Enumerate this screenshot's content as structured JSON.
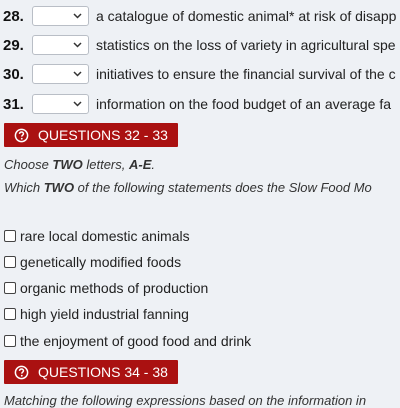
{
  "questions": [
    {
      "number": "28.",
      "text": "a catalogue of domestic animal* at risk of disapp",
      "selected": ""
    },
    {
      "number": "29.",
      "text": "statistics on the loss of variety in agricultural spe",
      "selected": ""
    },
    {
      "number": "30.",
      "text": "initiatives to ensure the financial survival of the c",
      "selected": ""
    },
    {
      "number": "31.",
      "text": "information on the food budget of an average fa",
      "selected": ""
    }
  ],
  "section_32_33": {
    "banner": "QUESTIONS 32 - 33",
    "instruction1": {
      "pre": "Choose ",
      "b1": "TWO",
      "mid": " letters, ",
      "b2": "A-E",
      "post": "."
    },
    "instruction2": {
      "pre": "Which ",
      "b1": "TWO",
      "post": " of the following statements does the Slow Food Mo"
    },
    "options": [
      "rare local domestic animals",
      "genetically modified foods",
      "organic methods of production",
      "high yield industrial fanning",
      "the enjoyment of good food and drink"
    ]
  },
  "section_34_38": {
    "banner": "QUESTIONS 34 - 38",
    "instruction": "Matching the following expressions based on the information in"
  },
  "colors": {
    "banner_bg": "#aa1111",
    "page_bg": "#eef1f5"
  },
  "icons": {
    "select": "chevron-down-icon",
    "banner": "question-circle-icon"
  }
}
